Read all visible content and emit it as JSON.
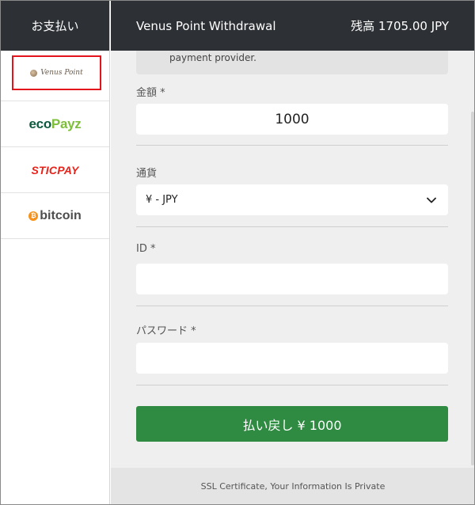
{
  "sidebar": {
    "title": "お支払い",
    "methods": [
      {
        "id": "venus-point",
        "logo_text": "Venus Point",
        "selected": true
      },
      {
        "id": "ecopayz",
        "logo_text_a": "eco",
        "logo_text_b": "Payz",
        "selected": false
      },
      {
        "id": "sticpay",
        "logo_text": "STICPAY",
        "selected": false
      },
      {
        "id": "bitcoin",
        "logo_symbol": "₿",
        "logo_text": "bitcoin",
        "selected": false
      }
    ]
  },
  "header": {
    "title": "Venus Point Withdrawal",
    "balance": "残高 1705.00 JPY"
  },
  "form": {
    "notice": "payment provider.",
    "amount_label": "金額 *",
    "amount_value": "1000",
    "currency_label": "通貨",
    "currency_value": "¥ - JPY",
    "id_label": "ID *",
    "id_value": "",
    "password_label": "パスワード *",
    "password_value": "",
    "submit_label": "払い戻し ¥ 1000"
  },
  "footer": {
    "text": "SSL Certificate, Your Information Is Private"
  },
  "colors": {
    "header_bg": "#2d3035",
    "submit_bg": "#2e8b41",
    "selected_outline": "#e3141b"
  }
}
